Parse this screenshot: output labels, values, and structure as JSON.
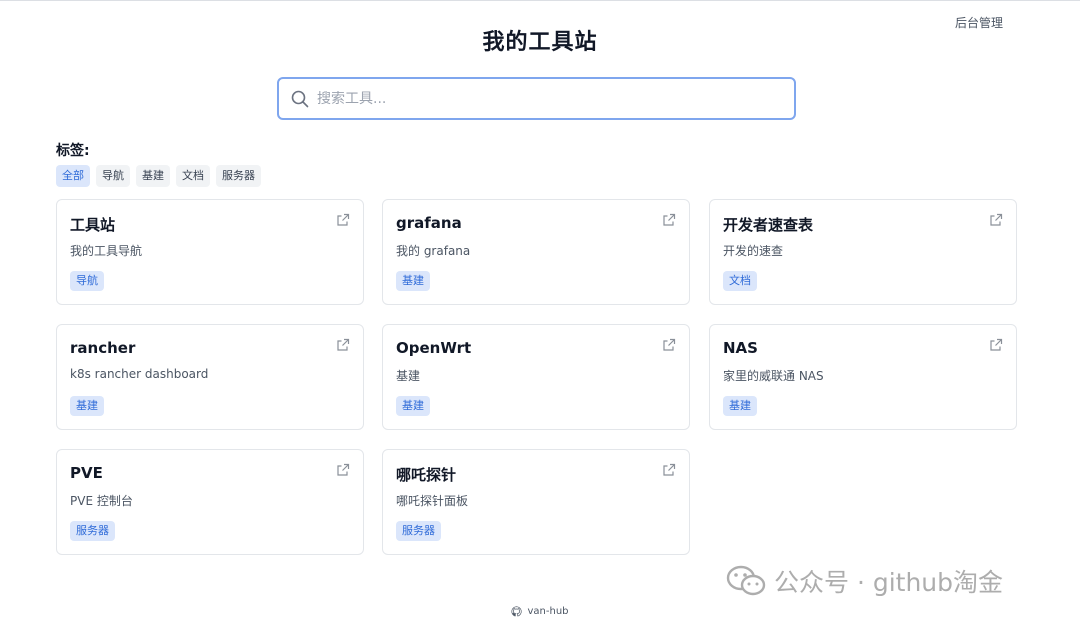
{
  "header": {
    "admin_link": "后台管理",
    "title": "我的工具站"
  },
  "search": {
    "placeholder": "搜索工具..."
  },
  "tags": {
    "label": "标签:",
    "items": [
      "全部",
      "导航",
      "基建",
      "文档",
      "服务器"
    ],
    "active": "全部"
  },
  "cards": [
    {
      "title": "工具站",
      "desc": "我的工具导航",
      "tag": "导航"
    },
    {
      "title": "grafana",
      "desc": "我的 grafana",
      "tag": "基建"
    },
    {
      "title": "开发者速查表",
      "desc": "开发的速查",
      "tag": "文档"
    },
    {
      "title": "rancher",
      "desc": "k8s rancher dashboard",
      "tag": "基建"
    },
    {
      "title": "OpenWrt",
      "desc": "基建",
      "tag": "基建"
    },
    {
      "title": "NAS",
      "desc": "家里的威联通 NAS",
      "tag": "基建"
    },
    {
      "title": "PVE",
      "desc": "PVE 控制台",
      "tag": "服务器"
    },
    {
      "title": "哪吒探针",
      "desc": "哪吒探针面板",
      "tag": "服务器"
    }
  ],
  "footer": {
    "label": "van-hub",
    "icon": "github-icon"
  },
  "watermark": {
    "text": "公众号 · github淘金",
    "icon": "wechat-icon"
  },
  "colors": {
    "accent": "#2f6bd8",
    "tag_bg": "#dbe6fb",
    "search_border": "#7fa6ee"
  }
}
